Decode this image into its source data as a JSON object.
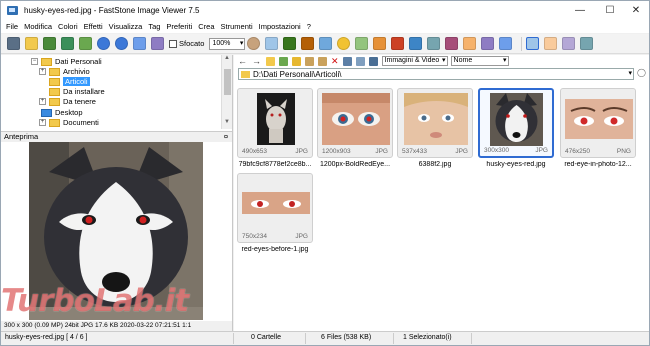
{
  "window": {
    "title": "husky-eyes-red.jpg  -  FastStone Image Viewer 7.5",
    "minimize": "—",
    "maximize": "☐",
    "close": "✕"
  },
  "menu": [
    "File",
    "Modifica",
    "Colori",
    "Effetti",
    "Visualizza",
    "Tag",
    "Preferiti",
    "Crea",
    "Strumenti",
    "Impostazioni",
    "?"
  ],
  "toolbar": {
    "sfocato_label": "Sfocato",
    "zoom_value": "100%"
  },
  "tree": {
    "items": [
      {
        "label": "Dati Personali",
        "level": 1,
        "expand": "−"
      },
      {
        "label": "Archivio",
        "level": 2,
        "expand": "+"
      },
      {
        "label": "Articoli",
        "level": 2,
        "expand": "",
        "selected": true
      },
      {
        "label": "Da installare",
        "level": 2,
        "expand": ""
      },
      {
        "label": "Da tenere",
        "level": 2,
        "expand": "+"
      },
      {
        "label": "Desktop",
        "level": 1,
        "expand": "",
        "blue": true
      },
      {
        "label": "Documenti",
        "level": 1,
        "expand": "+"
      }
    ]
  },
  "preview": {
    "header": "Anteprima",
    "close": "¤",
    "info": "300 x 300 (0.09 MP)  24bit  JPG   17.6 KB   2020-03-22 07:21:51   1:1"
  },
  "filter": {
    "type": "Immagini & Video",
    "sort": "Nome"
  },
  "path": "D:\\Dati Personali\\Articoli\\",
  "thumbnails": [
    {
      "name": "79bfc9cf8778ef2ce8b...",
      "dims": "490x653",
      "format": "JPG",
      "kind": "dog"
    },
    {
      "name": "1200px-BoldRedEye...",
      "dims": "1200x903",
      "format": "JPG",
      "kind": "eyes"
    },
    {
      "name": "6388f2.jpg",
      "dims": "537x433",
      "format": "JPG",
      "kind": "child"
    },
    {
      "name": "husky-eyes-red.jpg",
      "dims": "300x300",
      "format": "JPG",
      "kind": "husky",
      "active": true
    },
    {
      "name": "red-eye-in-photo-12...",
      "dims": "476x250",
      "format": "PNG",
      "kind": "eyes2"
    },
    {
      "name": "red-eyes-before-1.jpg",
      "dims": "750x234",
      "format": "JPG",
      "kind": "strip"
    }
  ],
  "status": {
    "file": "husky-eyes-red.jpg [ 4 / 6 ]",
    "folders": "0 Cartelle",
    "files": "6 Files (538 KB)",
    "selected": "1 Selezionato(i)"
  },
  "watermark": "TurboLab.it",
  "colors": {
    "selection": "#3399ff",
    "active_border": "#2f6bd2",
    "folder": "#f2c94c"
  }
}
